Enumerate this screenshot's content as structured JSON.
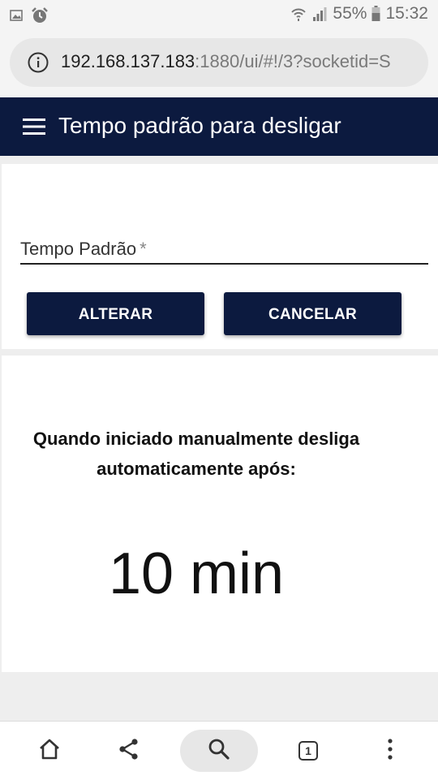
{
  "status_bar": {
    "battery_percent": "55%",
    "time": "15:32",
    "left_icons": [
      "image-icon",
      "alarm-icon"
    ],
    "right_icons": [
      "wifi-icon",
      "signal-icon",
      "battery-icon"
    ]
  },
  "browser": {
    "url_host": "192.168.137.183",
    "url_path": ":1880/ui/#!/3?socketid=S"
  },
  "toolbar": {
    "title": "Tempo padrão para desligar"
  },
  "form": {
    "field_label": "Tempo Padrão",
    "required_marker": "*",
    "field_value": "",
    "alter_button": "ALTERAR",
    "cancel_button": "CANCELAR"
  },
  "info": {
    "description_line1": "Quando iniciado manualmente desliga",
    "description_line2": "automaticamente após:",
    "value": "10 min"
  },
  "bottom_nav": {
    "tab_count": "1",
    "items": [
      "home-icon",
      "share-icon",
      "search-icon",
      "tabs-icon",
      "more-icon"
    ]
  },
  "colors": {
    "primary": "#0c1a3f",
    "page_background": "#eeeeee",
    "card": "#ffffff"
  }
}
